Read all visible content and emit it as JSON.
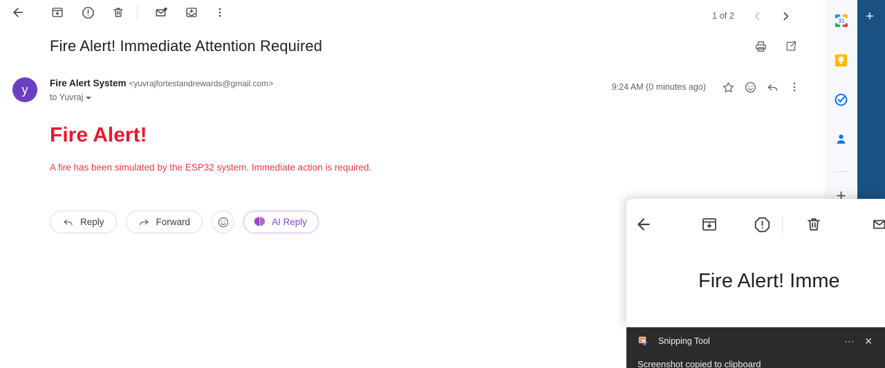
{
  "toolbar": {
    "back_label": "Back",
    "archive_label": "Archive",
    "report_spam_label": "Report spam",
    "delete_label": "Delete",
    "mark_unread_label": "Mark as unread",
    "move_to_inbox_label": "Move to Inbox",
    "more_label": "More"
  },
  "pager": {
    "count_text": "1 of 2",
    "prev_label": "Newer",
    "next_label": "Older"
  },
  "email": {
    "subject": "Fire Alert! Immediate Attention Required",
    "print_label": "Print all",
    "open_new_window_label": "Open in new window",
    "avatar_initial": "y",
    "sender_name": "Fire Alert System",
    "sender_email": "<yuvrajfortestandrewards@gmail.com>",
    "recipient": "to Yuvraj",
    "timestamp": "9:24 AM (0 minutes ago)",
    "star_label": "Star",
    "react_label": "Add emoji reaction",
    "reply_icon_label": "Reply",
    "more_label": "More",
    "body_heading": "Fire Alert!",
    "body_text": "A fire has been simulated by the ESP32 system. Immediate action is required."
  },
  "actions": {
    "reply": "Reply",
    "forward": "Forward",
    "emoji_label": "Add reaction",
    "ai_reply": "AI Reply"
  },
  "side_rail": {
    "calendar_label": "Calendar",
    "calendar_day": "31",
    "keep_label": "Keep",
    "tasks_label": "Tasks",
    "contacts_label": "Contacts",
    "add_label": "Get add-ons"
  },
  "blue_panel": {
    "add_label": "+"
  },
  "overlay": {
    "back_label": "Back",
    "archive_label": "Archive",
    "report_spam_label": "Report spam",
    "delete_label": "Delete",
    "mark_unread_label": "Mark as unread",
    "subject_clipped": "Fire Alert! Imme"
  },
  "toast": {
    "app_name": "Snipping Tool",
    "more_label": "⋯",
    "close_label": "✕",
    "message": "Screenshot copied to clipboard"
  },
  "colors": {
    "alert_red": "#e8192c",
    "body_red": "#e8394a",
    "avatar_purple": "#6c3ec0",
    "ai_purple": "#7b4dd8",
    "panel_blue": "#1a5183",
    "rail_bg": "#f6f8fc"
  }
}
